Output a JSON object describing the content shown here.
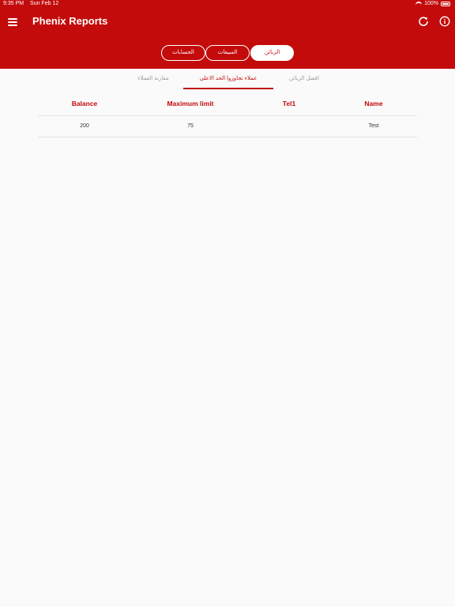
{
  "status_bar": {
    "time": "9:35 PM",
    "date": "Sun Feb 12",
    "battery_text": "100%"
  },
  "app_bar": {
    "title": "Phenix Reports",
    "menu_icon": "hamburger-menu-icon",
    "refresh_icon": "refresh-icon",
    "info_icon": "info-icon"
  },
  "segments": [
    {
      "label": "الزبائن",
      "active": true
    },
    {
      "label": "المبيعات",
      "active": false
    },
    {
      "label": "الحسابات",
      "active": false
    }
  ],
  "tabs": [
    {
      "label": "افضل الزبائن",
      "active": false
    },
    {
      "label": "عملاء تجاوزوا الحد الاعلى",
      "active": true
    },
    {
      "label": "مقارنة العملاء",
      "active": false
    }
  ],
  "table": {
    "headers": {
      "name": "Name",
      "tel1": "Tel1",
      "max_limit": "Maximum limit",
      "balance": "Balance"
    },
    "rows": [
      {
        "name": "Test",
        "tel1": "",
        "max_limit": "75",
        "balance": "200"
      }
    ]
  },
  "colors": {
    "primary": "#c30b0b",
    "background": "#fafafa"
  }
}
